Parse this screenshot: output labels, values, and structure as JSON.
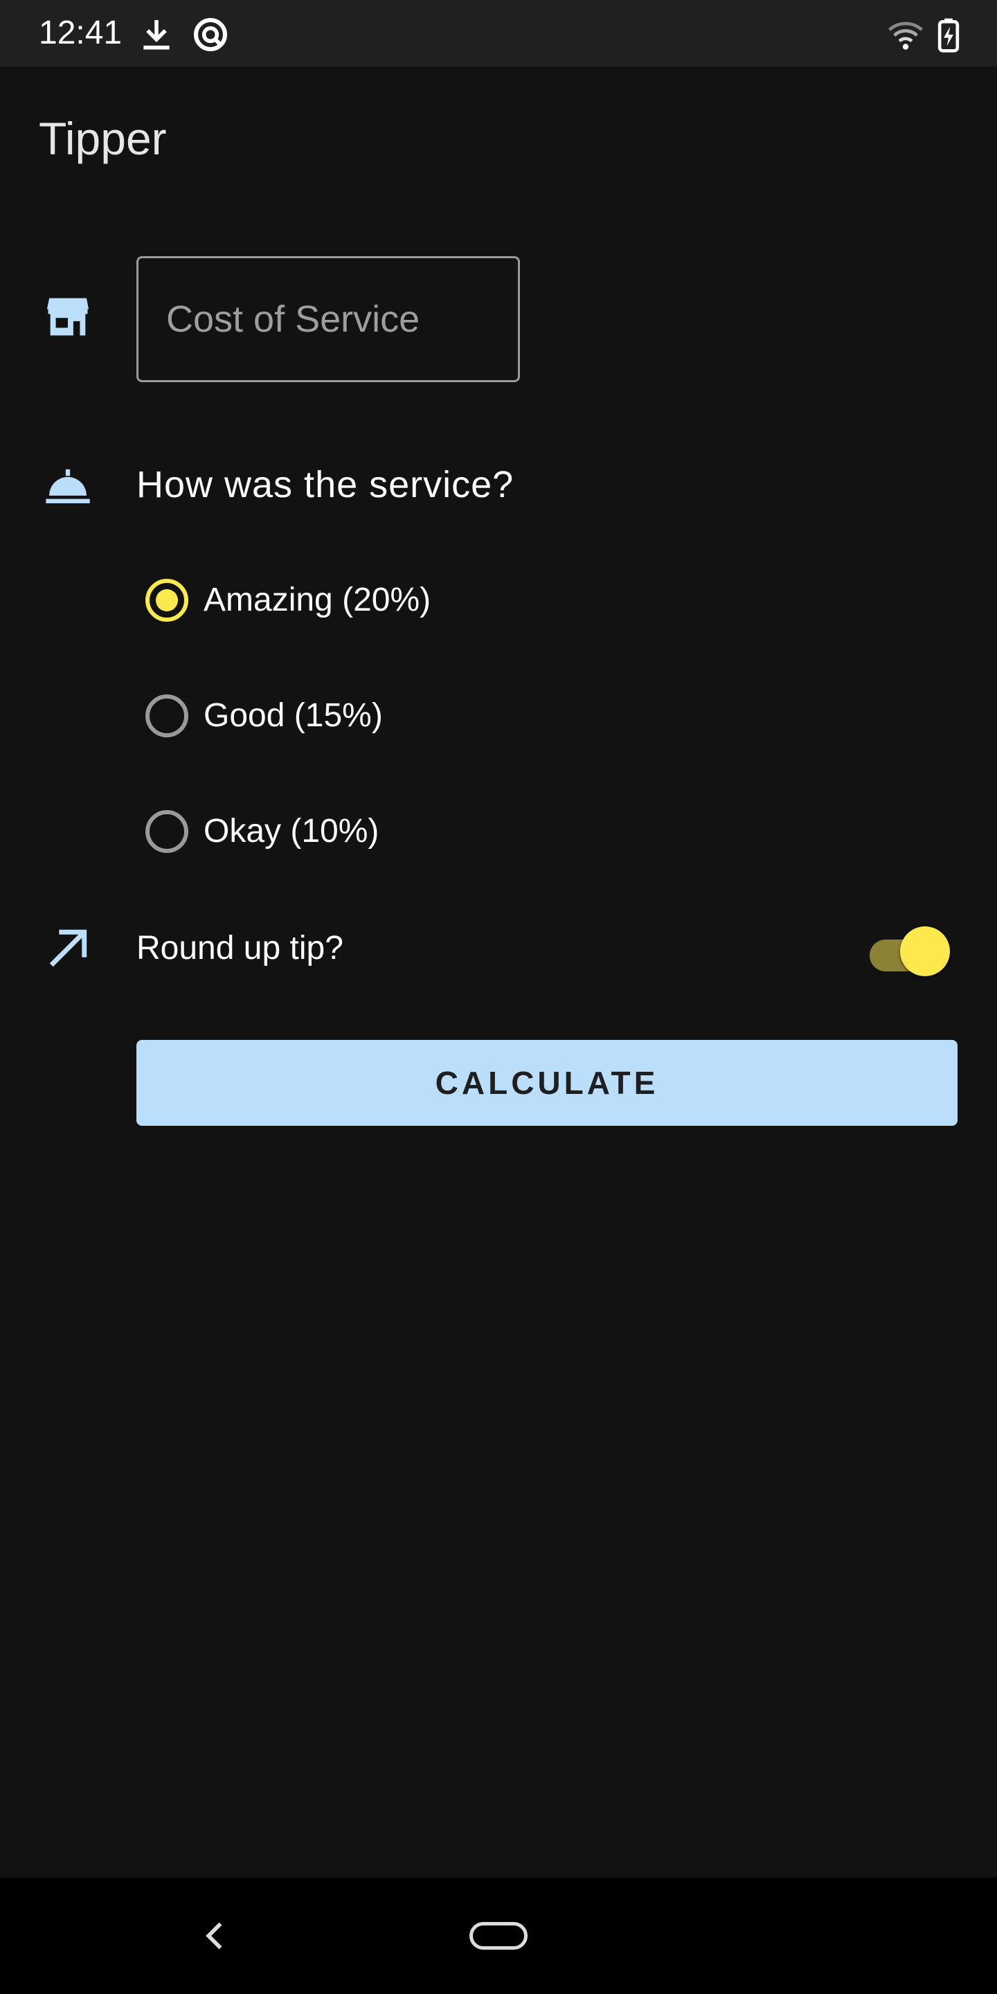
{
  "status_bar": {
    "time": "12:41",
    "icons": [
      "download-icon",
      "app-notification-icon",
      "wifi-icon",
      "battery-charging-icon"
    ]
  },
  "app_bar": {
    "title": "Tipper"
  },
  "cost_of_service": {
    "icon": "storefront-icon",
    "placeholder": "Cost of Service",
    "value": ""
  },
  "service_question": {
    "icon": "room-service-icon",
    "label": "How was the service?",
    "options": [
      {
        "label": "Amazing (20%)",
        "selected": true
      },
      {
        "label": "Good (15%)",
        "selected": false
      },
      {
        "label": "Okay (10%)",
        "selected": false
      }
    ]
  },
  "round_up": {
    "icon": "arrow-up-right-icon",
    "label": "Round up tip?",
    "enabled": true
  },
  "calculate_button": {
    "label": "CALCULATE"
  },
  "colors": {
    "background": "#121212",
    "accent": "#fbe94e",
    "icon_blue": "#bbdefb",
    "button": "#bbdefb"
  },
  "nav_bar": {
    "icons": [
      "back-icon",
      "home-pill-icon"
    ]
  }
}
